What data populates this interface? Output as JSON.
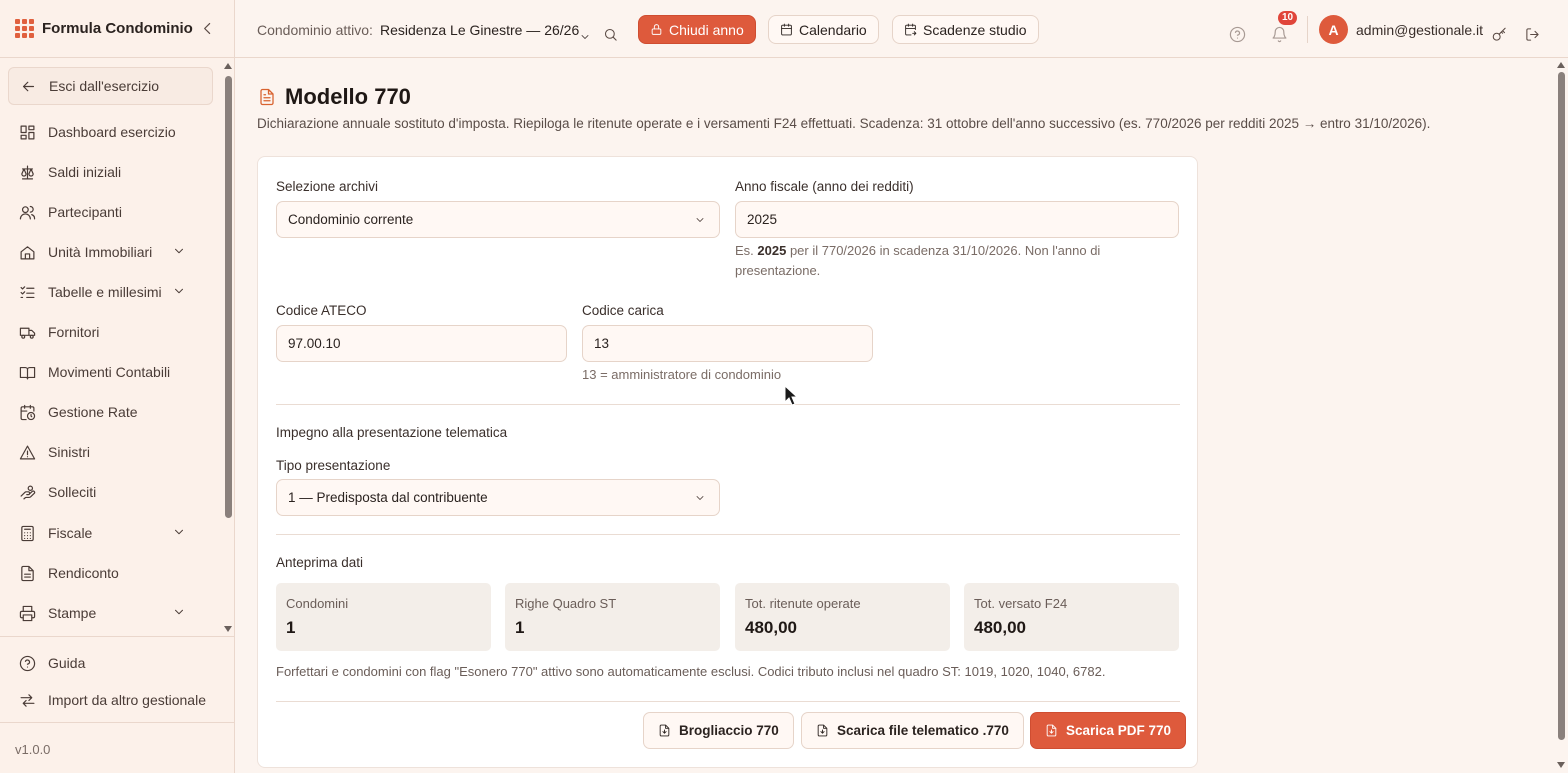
{
  "app": {
    "name": "Formula Condominio",
    "version": "v1.0.0"
  },
  "colors": {
    "accent": "#de5a3c",
    "background": "#fcf4ef",
    "badge": "#e0453a",
    "title_icon": "#d8622f"
  },
  "topbar": {
    "condominio_label": "Condominio attivo:",
    "condominio_value": "Residenza Le Ginestre — 26/26",
    "close_year": "Chiudi anno",
    "calendar": "Calendario",
    "deadlines": "Scadenze studio",
    "notifications_count": "10",
    "avatar_initial": "A",
    "user_email": "admin@gestionale.it"
  },
  "sidebar": {
    "exit": "Esci dall'esercizio",
    "items": [
      {
        "label": "Dashboard esercizio",
        "icon": "dashboard-icon"
      },
      {
        "label": "Saldi iniziali",
        "icon": "scale-icon"
      },
      {
        "label": "Partecipanti",
        "icon": "users-icon"
      },
      {
        "label": "Unità Immobiliari",
        "icon": "home-icon",
        "expandable": true
      },
      {
        "label": "Tabelle e millesimi",
        "icon": "list-check-icon",
        "expandable": true
      },
      {
        "label": "Fornitori",
        "icon": "truck-icon"
      },
      {
        "label": "Movimenti Contabili",
        "icon": "book-icon"
      },
      {
        "label": "Gestione Rate",
        "icon": "calendar-clock-icon"
      },
      {
        "label": "Sinistri",
        "icon": "warning-icon"
      },
      {
        "label": "Solleciti",
        "icon": "hand-coins-icon"
      },
      {
        "label": "Fiscale",
        "icon": "calculator-icon",
        "expandable": true
      },
      {
        "label": "Rendiconto",
        "icon": "document-icon"
      },
      {
        "label": "Stampe",
        "icon": "printer-icon",
        "expandable": true
      }
    ],
    "bottom": [
      {
        "label": "Guida",
        "icon": "help-circle-icon"
      },
      {
        "label": "Import da altro gestionale",
        "icon": "arrows-swap-icon"
      }
    ]
  },
  "page": {
    "title": "Modello 770",
    "description": "Dichiarazione annuale sostituto d'imposta. Riepiloga le ritenute operate e i versamenti F24 effettuati. Scadenza: 31 ottobre dell'anno successivo (es. 770/2026 per redditi 2025 → entro 31/10/2026)."
  },
  "form": {
    "archive_label": "Selezione archivi",
    "archive_value": "Condominio corrente",
    "year_label": "Anno fiscale (anno dei redditi)",
    "year_value": "2025",
    "year_hint_pre": "Es. ",
    "year_hint_bold": "2025",
    "year_hint_post": " per il 770/2026 in scadenza 31/10/2026. Non l'anno di presentazione.",
    "ateco_label": "Codice ATECO",
    "ateco_value": "97.00.10",
    "carica_label": "Codice carica",
    "carica_value": "13",
    "carica_hint": "13 = amministratore di condominio",
    "telematic_title": "Impegno alla presentazione telematica",
    "presentation_label": "Tipo presentazione",
    "presentation_value": "1 — Predisposta dal contribuente"
  },
  "preview": {
    "title": "Anteprima dati",
    "stats": [
      {
        "label": "Condomini",
        "value": "1"
      },
      {
        "label": "Righe Quadro ST",
        "value": "1"
      },
      {
        "label": "Tot. ritenute operate",
        "value": "480,00"
      },
      {
        "label": "Tot. versato F24",
        "value": "480,00"
      }
    ],
    "note": "Forfettari e condomini con flag \"Esonero 770\" attivo sono automaticamente esclusi. Codici tributo inclusi nel quadro ST: 1019, 1020, 1040, 6782."
  },
  "actions": {
    "draft": "Brogliaccio 770",
    "telematic": "Scarica file telematico .770",
    "pdf": "Scarica PDF 770"
  }
}
